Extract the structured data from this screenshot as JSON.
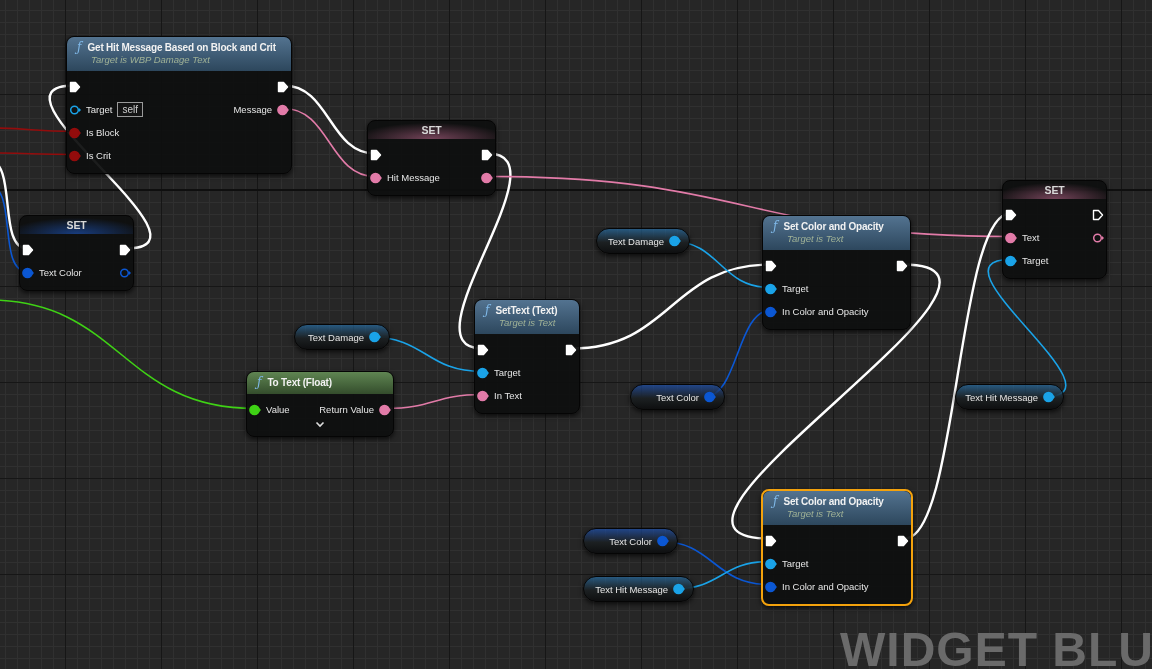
{
  "nodes": [
    {
      "kind": "function",
      "glyph": "ƒ",
      "title": "Get Hit Message Based on Block and Crit",
      "subtitle": "Target is WBP Damage Text",
      "selected": false,
      "inputs": [
        {
          "kind": "exec",
          "connected": true
        },
        {
          "kind": "object",
          "label": "Target",
          "default": "self",
          "connected": false
        },
        {
          "kind": "bool",
          "label": "Is Block",
          "connected": true
        },
        {
          "kind": "bool",
          "label": "Is Crit",
          "connected": true
        }
      ],
      "outputs": [
        {
          "kind": "exec",
          "connected": true
        },
        {
          "kind": "text",
          "label": "Message",
          "connected": true
        }
      ]
    },
    {
      "kind": "set",
      "title": "SET",
      "selected": false,
      "inputs": [
        {
          "kind": "exec",
          "connected": true
        },
        {
          "kind": "text",
          "label": "Hit Message",
          "connected": true
        }
      ],
      "outputs": [
        {
          "kind": "exec",
          "connected": true
        },
        {
          "kind": "text",
          "connected": true
        }
      ]
    },
    {
      "kind": "set",
      "title": "SET",
      "selected": false,
      "inputs": [
        {
          "kind": "exec",
          "connected": true
        },
        {
          "kind": "color",
          "label": "Text Color",
          "connected": true
        }
      ],
      "outputs": [
        {
          "kind": "exec",
          "connected": true
        },
        {
          "kind": "color",
          "connected": false
        }
      ]
    },
    {
      "kind": "get",
      "label": "Text Damage",
      "outputs": [
        {
          "kind": "object",
          "connected": true
        }
      ]
    },
    {
      "kind": "function",
      "glyph": "ƒ",
      "title": "Set Color and Opacity",
      "subtitle": "Target is Text",
      "selected": false,
      "inputs": [
        {
          "kind": "exec",
          "connected": true
        },
        {
          "kind": "object",
          "label": "Target",
          "connected": true
        },
        {
          "kind": "color",
          "label": "In Color and Opacity",
          "connected": true
        }
      ],
      "outputs": [
        {
          "kind": "exec",
          "connected": true
        }
      ]
    },
    {
      "kind": "set",
      "title": "SET",
      "selected": false,
      "inputs": [
        {
          "kind": "exec",
          "connected": true
        },
        {
          "kind": "text",
          "label": "Text",
          "connected": true
        },
        {
          "kind": "object",
          "label": "Target",
          "connected": true
        }
      ],
      "outputs": [
        {
          "kind": "exec",
          "connected": false
        },
        {
          "kind": "text",
          "connected": false
        }
      ]
    },
    {
      "kind": "get",
      "label": "Text Damage",
      "outputs": [
        {
          "kind": "object",
          "connected": true
        }
      ]
    },
    {
      "kind": "function",
      "glyph": "ƒ",
      "title": "SetText (Text)",
      "subtitle": "Target is Text",
      "selected": false,
      "inputs": [
        {
          "kind": "exec",
          "connected": true
        },
        {
          "kind": "object",
          "label": "Target",
          "connected": true
        },
        {
          "kind": "text",
          "label": "In Text",
          "connected": true
        }
      ],
      "outputs": [
        {
          "kind": "exec",
          "connected": true
        }
      ]
    },
    {
      "kind": "pure_function",
      "glyph": "ƒ",
      "title": "To Text (Float)",
      "selected": false,
      "expandable": true,
      "inputs": [
        {
          "kind": "float",
          "label": "Value",
          "connected": true
        }
      ],
      "outputs": [
        {
          "kind": "text",
          "label": "Return Value",
          "connected": true
        }
      ]
    },
    {
      "kind": "get",
      "label": "Text Color",
      "outputs": [
        {
          "kind": "color",
          "connected": true
        }
      ]
    },
    {
      "kind": "get",
      "label": "Text Hit Message",
      "outputs": [
        {
          "kind": "object",
          "connected": true
        }
      ]
    },
    {
      "kind": "get",
      "label": "Text Color",
      "outputs": [
        {
          "kind": "color",
          "connected": true
        }
      ]
    },
    {
      "kind": "get",
      "label": "Text Hit Message",
      "outputs": [
        {
          "kind": "object",
          "connected": true
        }
      ]
    },
    {
      "kind": "function",
      "glyph": "ƒ",
      "title": "Set Color and Opacity",
      "subtitle": "Target is Text",
      "selected": true,
      "inputs": [
        {
          "kind": "exec",
          "connected": true
        },
        {
          "kind": "object",
          "label": "Target",
          "connected": true
        },
        {
          "kind": "color",
          "label": "In Color and Opacity",
          "connected": true
        }
      ],
      "outputs": [
        {
          "kind": "exec",
          "connected": true
        }
      ]
    }
  ],
  "graph_label": "WIDGET BLU"
}
